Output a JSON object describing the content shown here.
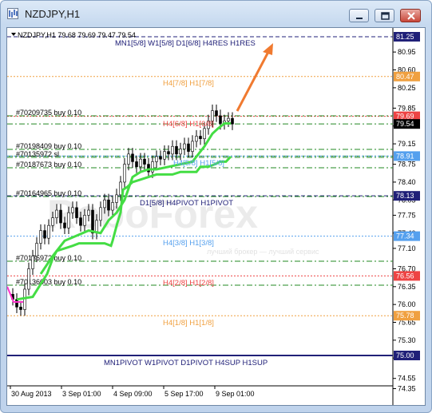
{
  "window": {
    "title": "NZDJPY,H1"
  },
  "colors": {
    "blue_line": "#1f1f8f",
    "orange_line": "#f0a040",
    "red_line": "#ee4444",
    "green_line": "#228822",
    "light_blue": "#55a0ee",
    "navy": "#202078",
    "green_ma": "#44dd44",
    "arrow": "#f07a30",
    "watermark": "#e8e8e8"
  },
  "chart": {
    "info_line": "NZDJPY,H1  79.68 79.69 79.47 79.54",
    "watermark": "RoboForex",
    "watermark_sub": "лучший брокер — лучший сервис"
  },
  "chart_data": {
    "type": "candlestick",
    "y_ticks": [
      "80.95",
      "80.60",
      "80.25",
      "79.85",
      "79.50",
      "79.15",
      "78.75",
      "78.40",
      "78.05",
      "77.75",
      "77.40",
      "77.10",
      "76.70",
      "76.35",
      "76.00",
      "75.65",
      "75.30",
      "74.95",
      "74.55",
      "74.35"
    ],
    "x_ticks": [
      "30 Aug 2013",
      "3 Sep 01:00",
      "4 Sep 09:00",
      "5 Sep 17:00",
      "9 Sep 01:00"
    ],
    "price_boxes": [
      {
        "value": "81.25",
        "bg": "#202078",
        "fg": "#ffffff"
      },
      {
        "value": "80.47",
        "bg": "#f0a040",
        "fg": "#ffffff"
      },
      {
        "value": "79.69",
        "bg": "#ee4444",
        "fg": "#ffffff"
      },
      {
        "value": "79.54",
        "bg": "#000000",
        "fg": "#ffffff"
      },
      {
        "value": "78.91",
        "bg": "#55a0ee",
        "fg": "#ffffff"
      },
      {
        "value": "78.13",
        "bg": "#202078",
        "fg": "#ffffff"
      },
      {
        "value": "77.34",
        "bg": "#55a0ee",
        "fg": "#ffffff"
      },
      {
        "value": "76.56",
        "bg": "#ee4444",
        "fg": "#ffffff"
      },
      {
        "value": "75.78",
        "bg": "#f0a040",
        "fg": "#ffffff"
      },
      {
        "value": "75.00",
        "bg": "#202078",
        "fg": "#ffffff"
      }
    ],
    "level_labels": [
      {
        "text": "MN1[5/8] W1[5/8] D1[6/8] H4RES H1RES",
        "color": "#202078"
      },
      {
        "text": "H4[7/8] H1[7/8]",
        "color": "#f0a040"
      },
      {
        "text": "H4[6/8] H1[6/8]",
        "color": "#ee4444"
      },
      {
        "text": "H4[5/8] H1[5/8]",
        "color": "#55a0ee"
      },
      {
        "text": "D1[5/8] H4PIVOT H1PIVOT",
        "color": "#202078"
      },
      {
        "text": "H4[3/8] H1[3/8]",
        "color": "#55a0ee"
      },
      {
        "text": "H4[2/8] H1[2/8]",
        "color": "#ee4444"
      },
      {
        "text": "H4[1/8] H1[1/8]",
        "color": "#f0a040"
      },
      {
        "text": "MN1PIVOT W1PIVOT D1PIVOT H4SUP H1SUP",
        "color": "#202078"
      }
    ],
    "orders": [
      "#70209735 buy 0.10",
      "#70198409 buy 0.10",
      "#70135972 sl",
      "#70187673 buy 0.10",
      "#70164965 buy 0.10",
      "#70135972 buy 0.10",
      "#70136003 buy 0.10"
    ]
  }
}
